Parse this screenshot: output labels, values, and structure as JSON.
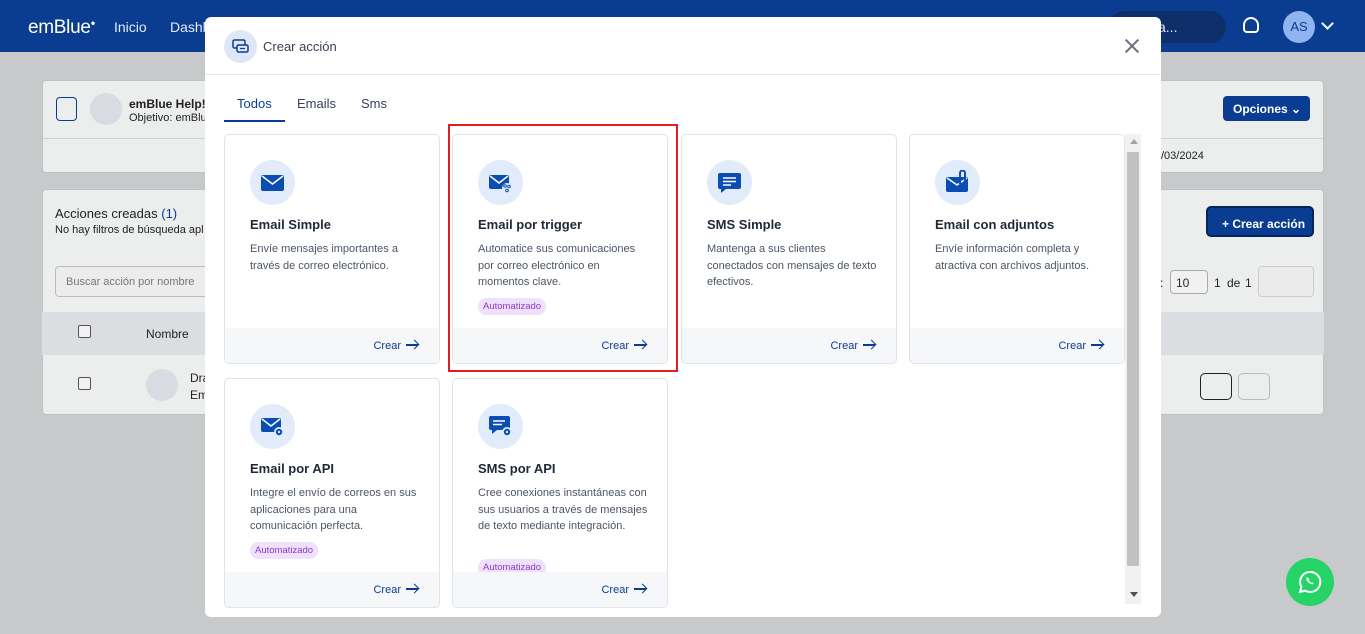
{
  "app": {
    "logo": "emBlue",
    "nav": [
      "Inicio",
      "Dashb"
    ],
    "search_text": "a...",
    "avatar_initials": "AS"
  },
  "background": {
    "campaign_title": "emBlue Help!",
    "campaign_objective": "Objetivo: emBlu",
    "options_button": "Opciones",
    "date_fragment": "/03/2024",
    "actions_title": "Acciones creadas",
    "actions_count": "(1)",
    "no_filters": "No hay filtros de búsqueda apl",
    "create_action_button": "+ Crear acción",
    "search_placeholder": "Buscar acción por nombre",
    "column_name": "Nombre",
    "pagination_prefix": ":",
    "page_size": "10",
    "page_current": "1",
    "page_of": "de",
    "page_total": "1",
    "row_name_fragment": "Dra",
    "row_type_fragment": "Em"
  },
  "modal": {
    "title": "Crear acción",
    "tabs": [
      {
        "label": "Todos",
        "active": true
      },
      {
        "label": "Emails",
        "active": false
      },
      {
        "label": "Sms",
        "active": false
      }
    ],
    "cards": [
      {
        "icon": "envelope-icon",
        "title": "Email Simple",
        "description": "Envíe mensajes importantes a través de correo electrónico.",
        "badge": "",
        "action": "Crear"
      },
      {
        "icon": "envelope-trigger-icon",
        "title": "Email por trigger",
        "description": "Automatice sus comunicaciones por correo electrónico en momentos clave.",
        "badge": "Automatizado",
        "action": "Crear"
      },
      {
        "icon": "sms-icon",
        "title": "SMS Simple",
        "description": "Mantenga a sus clientes conectados con mensajes de texto efectivos.",
        "badge": "",
        "action": "Crear"
      },
      {
        "icon": "envelope-attachment-icon",
        "title": "Email con adjuntos",
        "description": "Envíe información completa y atractiva con archivos adjuntos.",
        "badge": "",
        "action": "Crear"
      },
      {
        "icon": "envelope-api-icon",
        "title": "Email por API",
        "description": "Integre el envío de correos en sus aplicaciones para una comunicación perfecta.",
        "badge": "Automatizado",
        "action": "Crear"
      },
      {
        "icon": "sms-api-icon",
        "title": "SMS por API",
        "description": "Cree conexiones instantáneas con sus usuarios a través de mensajes de texto mediante integración.",
        "badge": "Automatizado",
        "action": "Crear"
      }
    ]
  },
  "colors": {
    "brand": "#0a3d91",
    "badge_bg": "#efe0fb",
    "badge_text": "#8b3cc7",
    "highlight": "#e11d23",
    "whatsapp": "#25d366"
  }
}
